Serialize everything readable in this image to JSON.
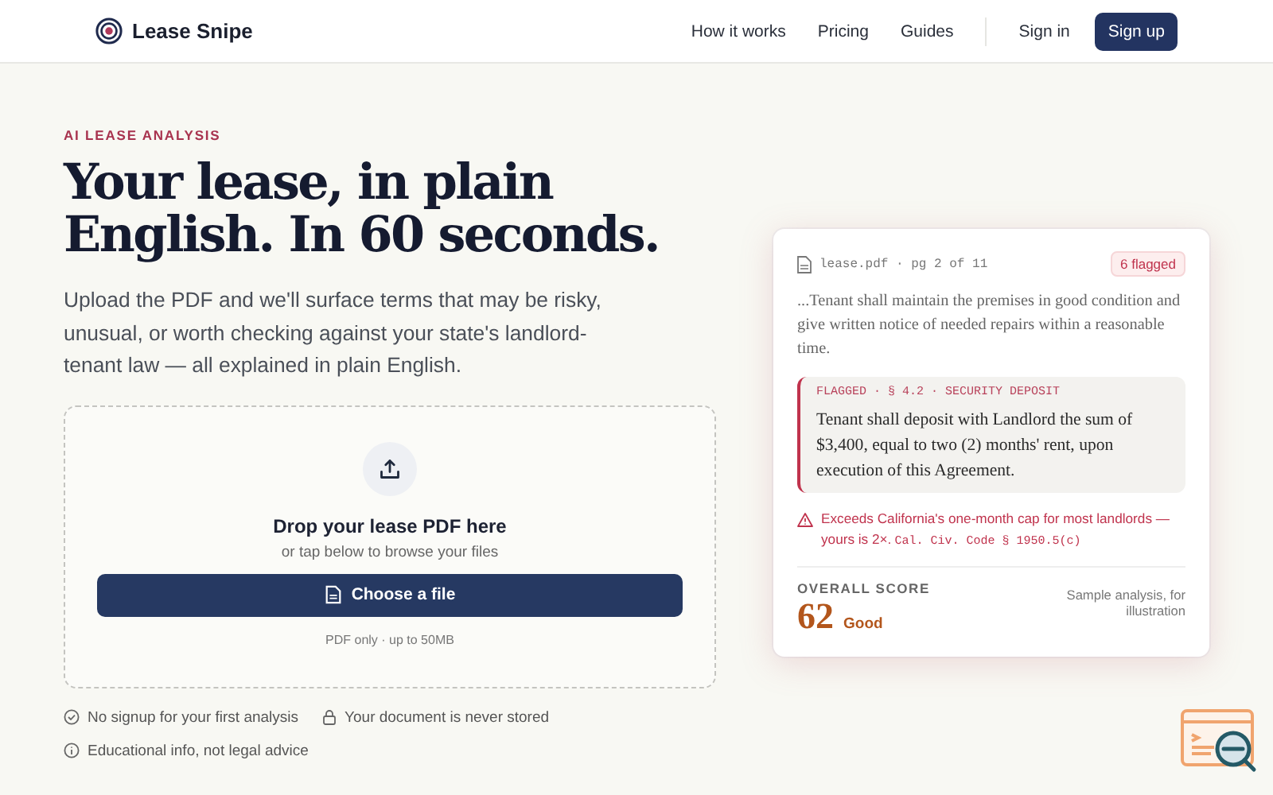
{
  "header": {
    "brand": "Lease Snipe",
    "nav": [
      {
        "label": "How it works"
      },
      {
        "label": "Pricing"
      },
      {
        "label": "Guides"
      }
    ],
    "sign_in": "Sign in",
    "sign_up": "Sign up"
  },
  "hero": {
    "eyebrow": "AI LEASE ANALYSIS",
    "title_lines": [
      "Your lease, in plain",
      "English. In 60 seconds."
    ],
    "lead": "Upload the PDF and we'll surface terms that may be risky, unusual, or worth checking against your state's landlord-tenant law — all explained in plain English."
  },
  "upload": {
    "title": "Drop your lease PDF here",
    "hint": "or tap below to browse your files",
    "button": "Choose a file",
    "note": "PDF only · up to 50MB"
  },
  "trust": [
    {
      "kind": "check",
      "text": "No signup for your first analysis"
    },
    {
      "kind": "lock",
      "text": "Your document is never stored"
    },
    {
      "kind": "info",
      "text": "Educational info, not legal advice"
    }
  ],
  "preview": {
    "file": "lease.pdf · pg 2 of 11",
    "badge": "6 flagged",
    "excerpt": "...Tenant shall maintain the premises in good condition and give written notice of needed repairs within a reasonable time.",
    "flag_label": "FLAGGED · § 4.2 · SECURITY DEPOSIT",
    "flag_text": "Tenant shall deposit with Landlord the sum of $3,400, equal to two (2) months' rent, upon execution of this Agreement.",
    "warning": "Exceeds California's one-month cap for most landlords — yours is 2×.",
    "warning_code": "Cal. Civ. Code § 1950.5(c)",
    "score_label": "OVERALL SCORE",
    "score": "62",
    "score_word": "Good",
    "sample_note": "Sample analysis, for illustration"
  }
}
